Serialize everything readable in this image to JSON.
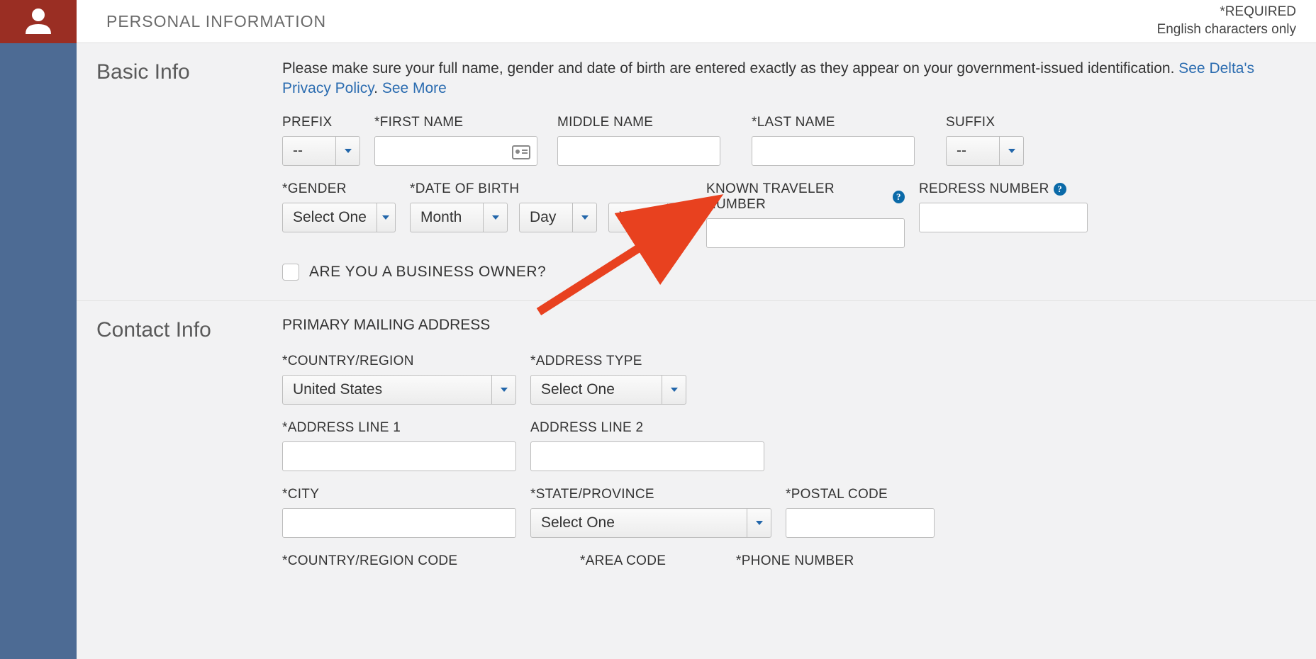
{
  "header": {
    "title": "PERSONAL INFORMATION",
    "required": "*REQUIRED",
    "english_only": "English characters only"
  },
  "basic": {
    "title": "Basic Info",
    "instructions": "Please make sure your full name, gender and date of birth are entered exactly as they appear on your government-issued identification.",
    "privacy_link": "See Delta's Privacy Policy",
    "period": ". ",
    "see_more": "See More",
    "labels": {
      "prefix": "PREFIX",
      "first_name": "*FIRST NAME",
      "middle_name": "MIDDLE NAME",
      "last_name": "*LAST NAME",
      "suffix": "SUFFIX",
      "gender": "*GENDER",
      "dob": "*DATE OF BIRTH",
      "known_traveler": "KNOWN TRAVELER NUMBER",
      "redress": "REDRESS NUMBER",
      "business_owner": "ARE YOU A BUSINESS OWNER?"
    },
    "values": {
      "prefix": "--",
      "suffix": "--",
      "gender": "Select One",
      "dob_month": "Month",
      "dob_day": "Day",
      "dob_year": "Year"
    }
  },
  "contact": {
    "title": "Contact Info",
    "subheading": "PRIMARY MAILING ADDRESS",
    "labels": {
      "country_region": "*COUNTRY/REGION",
      "address_type": "*ADDRESS TYPE",
      "address1": "*ADDRESS LINE 1",
      "address2": "ADDRESS LINE 2",
      "city": "*CITY",
      "state": "*STATE/PROVINCE",
      "postal": "*POSTAL CODE",
      "country_code": "*COUNTRY/REGION CODE",
      "area_code": "*AREA CODE",
      "phone": "*PHONE NUMBER"
    },
    "values": {
      "country_region": "United States",
      "address_type": "Select One",
      "state": "Select One"
    }
  }
}
